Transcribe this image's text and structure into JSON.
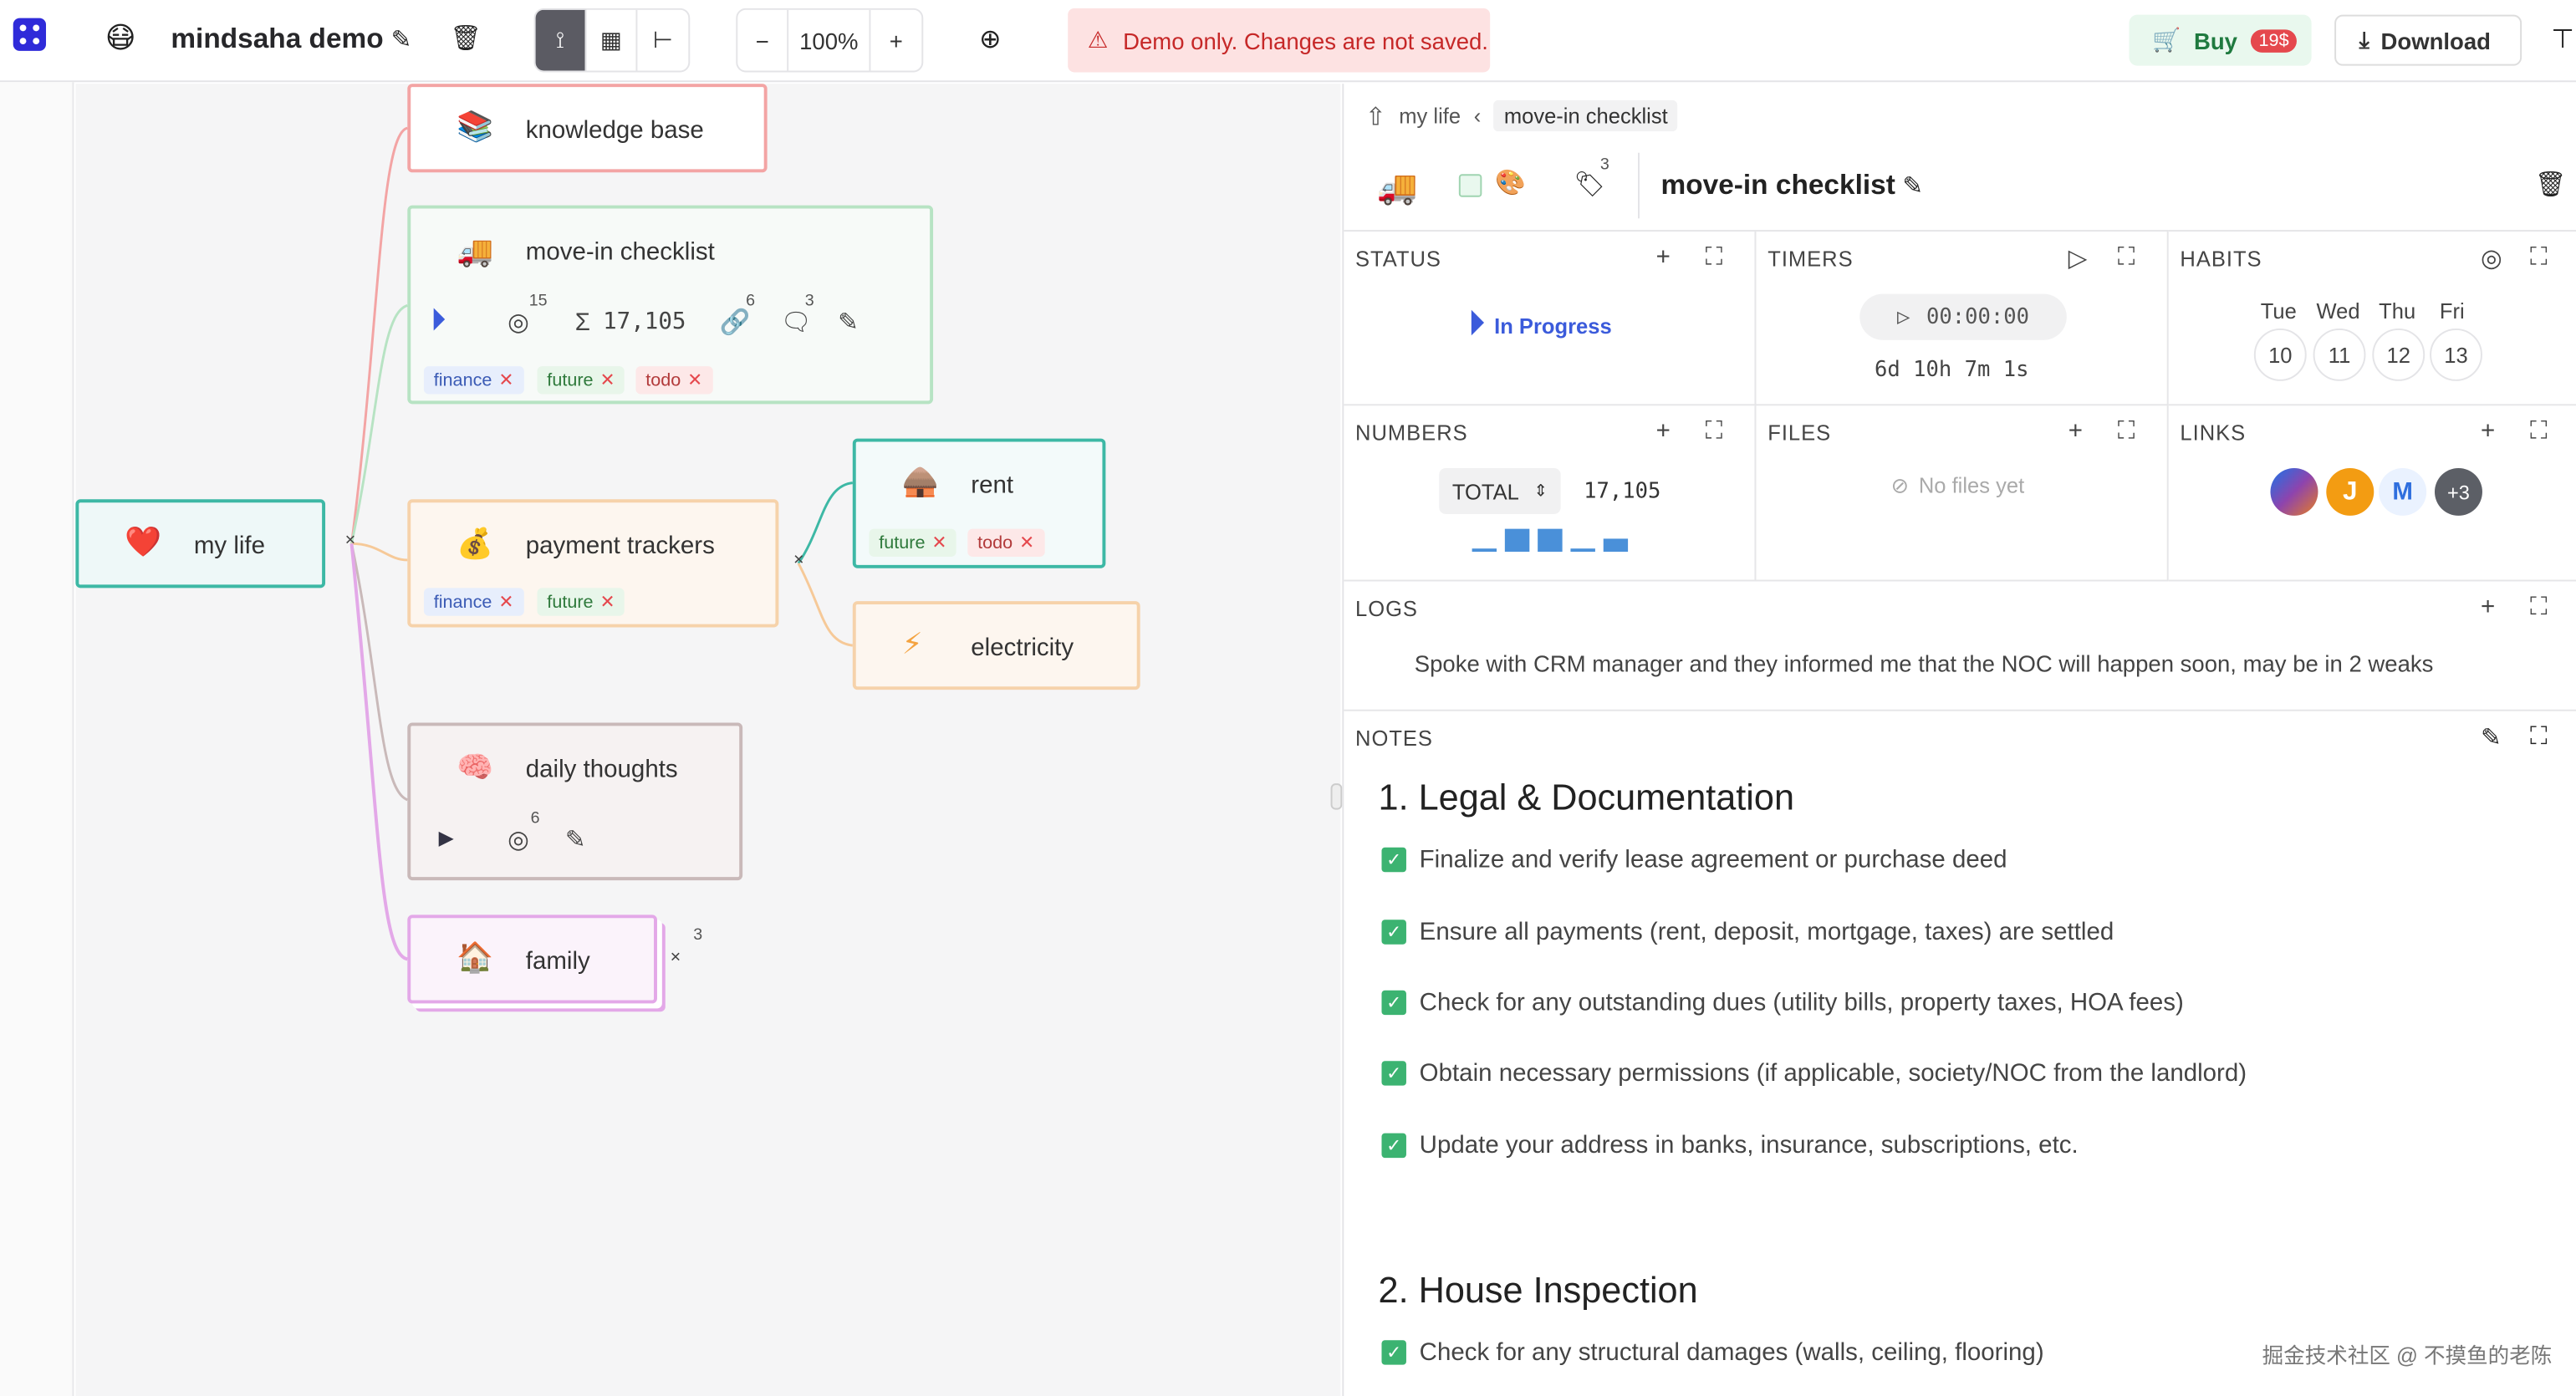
{
  "app": {
    "title": "mindsaha demo",
    "zoom": "100%",
    "warning": "Demo only. Changes are not saved.",
    "buy_label": "Buy",
    "price": "19$",
    "download_label": "Download"
  },
  "nodes": {
    "root": {
      "label": "my life",
      "emoji": "❤️"
    },
    "knowledge": {
      "label": "knowledge base",
      "emoji": "📚"
    },
    "movein": {
      "label": "move-in checklist",
      "emoji": "🚚",
      "goal_badge": "15",
      "sum": "17,105",
      "link_badge": "6",
      "comment_badge": "3",
      "tags": [
        {
          "t": "finance"
        },
        {
          "t": "future"
        },
        {
          "t": "todo"
        }
      ]
    },
    "payment": {
      "label": "payment trackers",
      "emoji": "💰",
      "tags": [
        {
          "t": "finance"
        },
        {
          "t": "future"
        }
      ]
    },
    "rent": {
      "label": "rent",
      "emoji": "🛖",
      "tags": [
        {
          "t": "future"
        },
        {
          "t": "todo"
        }
      ]
    },
    "electricity": {
      "label": "electricity",
      "emoji": "⚡"
    },
    "daily": {
      "label": "daily thoughts",
      "emoji": "🧠",
      "goal_badge": "6"
    },
    "family": {
      "label": "family",
      "emoji": "🏠",
      "collapsed_badge": "3"
    }
  },
  "panel": {
    "breadcrumb": {
      "parent": "my life",
      "current": "move-in checklist"
    },
    "title": "move-in checklist",
    "emoji": "🚚",
    "tags_badge": "3",
    "sections": {
      "status": {
        "title": "STATUS",
        "value": "In Progress"
      },
      "timers": {
        "title": "TIMERS",
        "clock": "00:00:00",
        "elapsed": "6d 10h 7m 1s"
      },
      "habits": {
        "title": "HABITS",
        "days": [
          {
            "d": "Tue",
            "n": "10"
          },
          {
            "d": "Wed",
            "n": "11"
          },
          {
            "d": "Thu",
            "n": "12"
          },
          {
            "d": "Fri",
            "n": "13"
          }
        ]
      },
      "numbers": {
        "title": "NUMBERS",
        "select": "TOTAL",
        "value": "17,105"
      },
      "files": {
        "title": "FILES",
        "empty": "No files yet"
      },
      "links": {
        "title": "LINKS",
        "more": "+3"
      },
      "logs": {
        "title": "LOGS",
        "text": "Spoke with CRM manager and they informed me that the NOC will happen soon, may be in 2 weaks"
      },
      "notes": {
        "title": "NOTES"
      }
    },
    "notes": {
      "h1": "1. Legal & Documentation",
      "items1": [
        "Finalize and verify lease agreement or purchase deed",
        "Ensure all payments (rent, deposit, mortgage, taxes) are settled",
        "Check for any outstanding dues (utility bills, property taxes, HOA fees)",
        "Obtain necessary permissions (if applicable, society/NOC from the landlord)",
        "Update your address in banks, insurance, subscriptions, etc."
      ],
      "h2": "2. House Inspection",
      "items2": [
        "Check for any structural damages (walls, ceiling, flooring)"
      ]
    }
  },
  "watermark": "掘金技术社区 @ 不摸鱼的老陈"
}
